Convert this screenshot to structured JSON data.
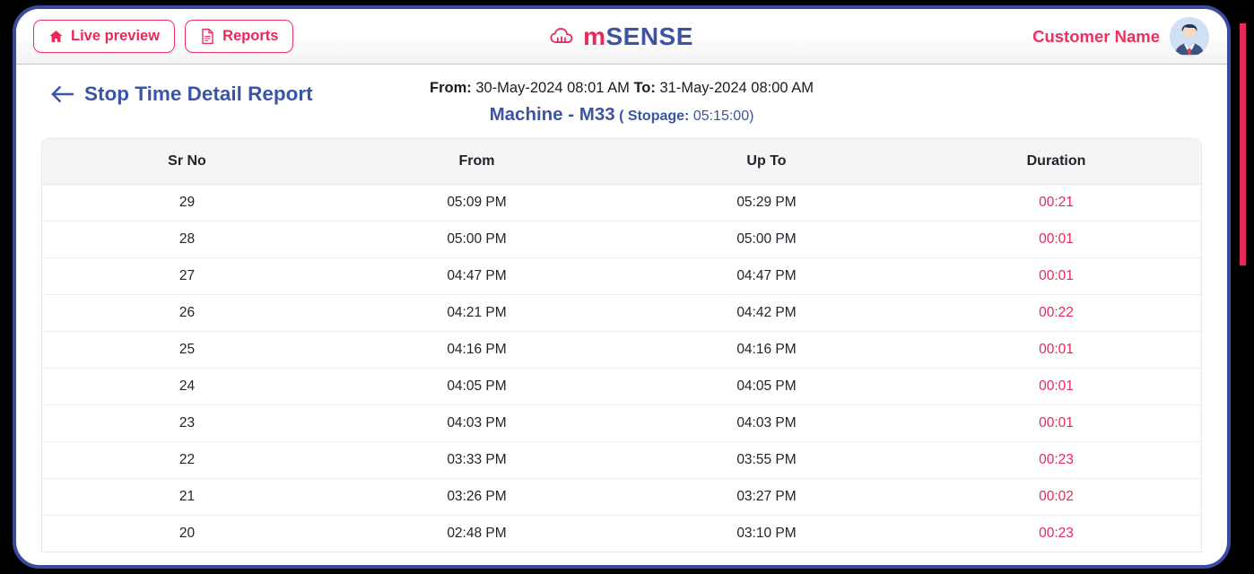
{
  "header": {
    "live_preview_label": "Live preview",
    "reports_label": "Reports",
    "logo_m": "m",
    "logo_sense": "SENSE",
    "customer_name": "Customer Name"
  },
  "report": {
    "title": "Stop Time Detail Report",
    "from_label": "From:",
    "from_value": "30-May-2024 08:01 AM",
    "to_label": "To:",
    "to_value": "31-May-2024 08:00 AM",
    "machine": "Machine - M33",
    "stopage_label": "( Stopage:",
    "stopage_value": "05:15:00)"
  },
  "table": {
    "columns": [
      "Sr No",
      "From",
      "Up To",
      "Duration"
    ],
    "rows": [
      {
        "sr": "29",
        "from": "05:09 PM",
        "upto": "05:29 PM",
        "duration": "00:21"
      },
      {
        "sr": "28",
        "from": "05:00 PM",
        "upto": "05:00 PM",
        "duration": "00:01"
      },
      {
        "sr": "27",
        "from": "04:47 PM",
        "upto": "04:47 PM",
        "duration": "00:01"
      },
      {
        "sr": "26",
        "from": "04:21 PM",
        "upto": "04:42 PM",
        "duration": "00:22"
      },
      {
        "sr": "25",
        "from": "04:16 PM",
        "upto": "04:16 PM",
        "duration": "00:01"
      },
      {
        "sr": "24",
        "from": "04:05 PM",
        "upto": "04:05 PM",
        "duration": "00:01"
      },
      {
        "sr": "23",
        "from": "04:03 PM",
        "upto": "04:03 PM",
        "duration": "00:01"
      },
      {
        "sr": "22",
        "from": "03:33 PM",
        "upto": "03:55 PM",
        "duration": "00:23"
      },
      {
        "sr": "21",
        "from": "03:26 PM",
        "upto": "03:27 PM",
        "duration": "00:02"
      },
      {
        "sr": "20",
        "from": "02:48 PM",
        "upto": "03:10 PM",
        "duration": "00:23"
      }
    ]
  },
  "colors": {
    "accent_pink": "#e8295a",
    "accent_blue": "#3b55a4",
    "frame_blue": "#3b4a9e"
  }
}
